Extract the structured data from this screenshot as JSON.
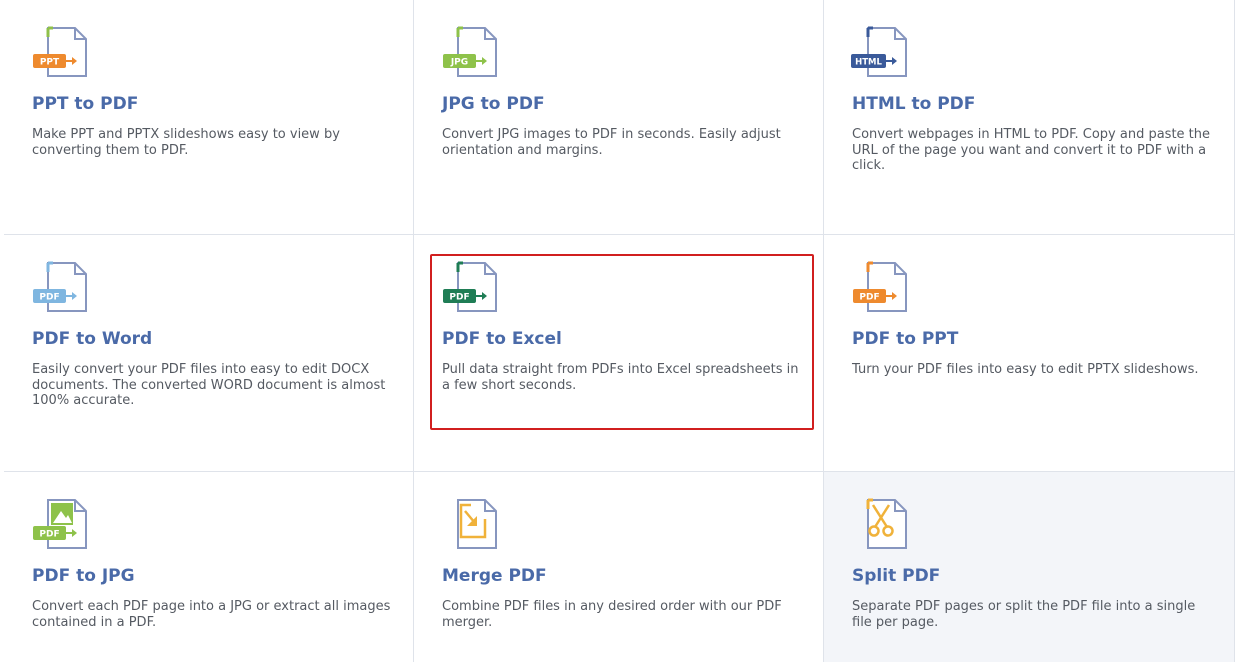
{
  "tools": [
    {
      "id": "ppt-to-pdf",
      "title": "PPT to PDF",
      "description": "Make PPT and PPTX slideshows easy to view by converting them to PDF.",
      "badge": "PPT",
      "badge_color": "#ee8a2e",
      "accent_color": "#8fc04a",
      "icon": "file-convert-icon"
    },
    {
      "id": "jpg-to-pdf",
      "title": "JPG to PDF",
      "description": "Convert JPG images to PDF in seconds. Easily adjust orientation and margins.",
      "badge": "JPG",
      "badge_color": "#8ec24a",
      "accent_color": "#8ec24a",
      "icon": "file-convert-icon"
    },
    {
      "id": "html-to-pdf",
      "title": "HTML to PDF",
      "description": "Convert webpages in HTML to PDF. Copy and paste the URL of the page you want and convert it to PDF with a click.",
      "badge": "HTML",
      "badge_color": "#3a5a9a",
      "accent_color": "#3a5a9a",
      "icon": "file-convert-icon"
    },
    {
      "id": "pdf-to-word",
      "title": "PDF to Word",
      "description": "Easily convert your PDF files into easy to edit DOCX documents. The converted WORD document is almost 100% accurate.",
      "badge": "PDF",
      "badge_color": "#7fb6e0",
      "accent_color": "#7fb6e0",
      "icon": "file-convert-icon"
    },
    {
      "id": "pdf-to-excel",
      "title": "PDF to Excel",
      "description": "Pull data straight from PDFs into Excel spreadsheets in a few short seconds.",
      "badge": "PDF",
      "badge_color": "#1f7d55",
      "accent_color": "#1f7d55",
      "icon": "file-convert-icon"
    },
    {
      "id": "pdf-to-ppt",
      "title": "PDF to PPT",
      "description": "Turn your PDF files into easy to edit PPTX slideshows.",
      "badge": "PDF",
      "badge_color": "#ee8a2e",
      "accent_color": "#ee8a2e",
      "icon": "file-convert-icon"
    },
    {
      "id": "pdf-to-jpg",
      "title": "PDF to JPG",
      "description": "Convert each PDF page into a JPG or extract all images contained in a PDF.",
      "badge": "PDF",
      "badge_color": "#8ec24a",
      "accent_color": "#8ec24a",
      "icon": "image-file-icon"
    },
    {
      "id": "merge-pdf",
      "title": "Merge PDF",
      "description": "Combine PDF files in any desired order with our PDF merger.",
      "badge": "",
      "badge_color": "#f0b23a",
      "accent_color": "#f0b23a",
      "icon": "merge-file-icon"
    },
    {
      "id": "split-pdf",
      "title": "Split PDF",
      "description": "Separate PDF pages or split the PDF file into a single file per page.",
      "badge": "",
      "badge_color": "#f0b23a",
      "accent_color": "#f0b23a",
      "icon": "scissors-file-icon"
    }
  ],
  "highlighted_tool": "pdf-to-excel",
  "hovered_tool": "split-pdf",
  "colors": {
    "title": "#4a6aa8",
    "description": "#555a62",
    "file_outline": "#8796bf",
    "highlight_border": "#d11f1f",
    "hover_background": "#f3f5f9"
  }
}
